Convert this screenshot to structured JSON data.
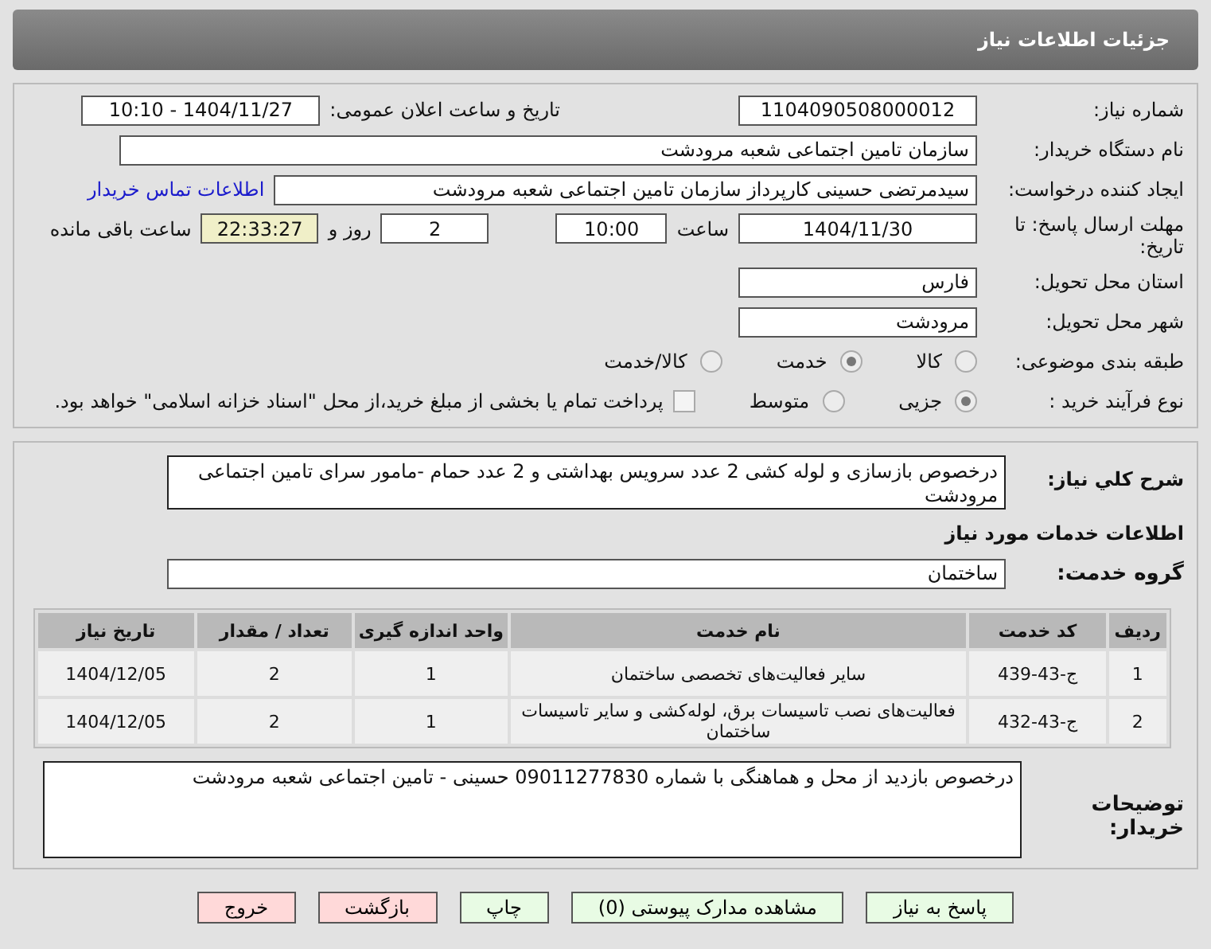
{
  "header": {
    "title": "جزئیات اطلاعات نیاز"
  },
  "need_number": {
    "label": "شماره نیاز:",
    "value": "1104090508000012"
  },
  "announce": {
    "label": "تاریخ و ساعت اعلان عمومی:",
    "value": "1404/11/27 - 10:10"
  },
  "buyer_org": {
    "label": "نام دستگاه خریدار:",
    "value": "سازمان تامین اجتماعی شعبه مرودشت"
  },
  "requester": {
    "label": "ایجاد کننده درخواست:",
    "value": "سیدمرتضی حسینی کارپرداز سازمان تامین اجتماعی شعبه مرودشت",
    "link": "اطلاعات تماس خریدار"
  },
  "deadline": {
    "label": "مهلت ارسال پاسخ: تا تاریخ:",
    "date": "1404/11/30",
    "time_label": "ساعت",
    "time": "10:00",
    "days": "2",
    "days_label": "روز و",
    "remaining": "22:33:27",
    "remaining_label": "ساعت باقی مانده"
  },
  "province": {
    "label": "استان محل تحویل:",
    "value": "فارس"
  },
  "city": {
    "label": "شهر محل تحویل:",
    "value": "مرودشت"
  },
  "category": {
    "label": "طبقه بندی موضوعی:",
    "options": [
      {
        "label": "کالا",
        "selected": false
      },
      {
        "label": "خدمت",
        "selected": true
      },
      {
        "label": "کالا/خدمت",
        "selected": false
      }
    ]
  },
  "process": {
    "label": "نوع فرآیند خرید :",
    "options": [
      {
        "label": "جزیی",
        "selected": true
      },
      {
        "label": "متوسط",
        "selected": false
      }
    ],
    "payment": {
      "checked": false,
      "text": "پرداخت تمام یا بخشی از مبلغ خرید،از محل \"اسناد خزانه اسلامی\" خواهد بود."
    }
  },
  "description": {
    "label": "شرح کلي نیاز:",
    "value": "درخصوص بازسازی و لوله کشی 2 عدد سرویس بهداشتی و 2 عدد حمام -مامور سرای تامین اجتماعی مرودشت"
  },
  "services_heading": "اطلاعات خدمات مورد نیاز",
  "service_group": {
    "label": "گروه خدمت:",
    "value": "ساختمان"
  },
  "table": {
    "columns": [
      "ردیف",
      "کد خدمت",
      "نام خدمت",
      "واحد اندازه گیری",
      "تعداد / مقدار",
      "تاریخ نیاز"
    ],
    "rows": [
      [
        "1",
        "ج-43-439",
        "سایر فعالیت‌های تخصصی ساختمان",
        "1",
        "2",
        "1404/12/05"
      ],
      [
        "2",
        "ج-43-432",
        "فعالیت‌های نصب تاسیسات برق، لوله‌کشی و سایر تاسیسات ساختمان",
        "1",
        "2",
        "1404/12/05"
      ]
    ]
  },
  "buyer_notes": {
    "label": "توضیحات خریدار:",
    "value": "درخصوص بازدید از محل و هماهنگی با شماره 09011277830 حسینی - تامین اجتماعی شعبه مرودشت"
  },
  "buttons": [
    {
      "label": "پاسخ به نیاز",
      "kind": "normal"
    },
    {
      "label": "مشاهده مدارک پیوستی (0)",
      "kind": "normal"
    },
    {
      "label": "چاپ",
      "kind": "normal"
    },
    {
      "label": "بازگشت",
      "kind": "danger"
    },
    {
      "label": "خروج",
      "kind": "danger"
    }
  ]
}
